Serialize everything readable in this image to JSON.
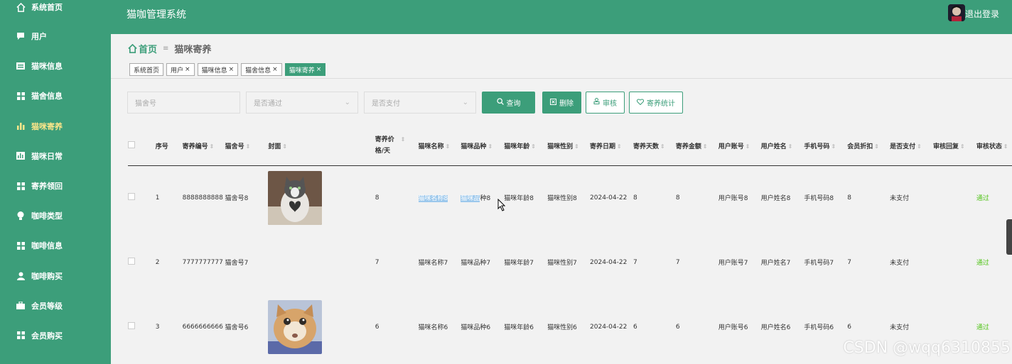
{
  "sidebar": {
    "items": [
      {
        "label": "系统首页",
        "icon": "home-icon"
      },
      {
        "label": "用户",
        "icon": "chat-icon"
      },
      {
        "label": "猫咪信息",
        "icon": "card-icon"
      },
      {
        "label": "猫舍信息",
        "icon": "grid-icon"
      },
      {
        "label": "猫咪寄养",
        "icon": "bar-chart-icon"
      },
      {
        "label": "猫咪日常",
        "icon": "chart-icon"
      },
      {
        "label": "寄养领回",
        "icon": "grid-icon"
      },
      {
        "label": "咖啡类型",
        "icon": "bulb-icon"
      },
      {
        "label": "咖啡信息",
        "icon": "grid-icon"
      },
      {
        "label": "咖啡购买",
        "icon": "user-icon"
      },
      {
        "label": "会员等级",
        "icon": "briefcase-icon"
      },
      {
        "label": "会员购买",
        "icon": "grid-icon"
      }
    ]
  },
  "header": {
    "title": "猫咖管理系统",
    "logout": "退出登录"
  },
  "breadcrumb": {
    "home": "首页",
    "sep": "≡",
    "current": "猫咪寄养"
  },
  "tabs": [
    "系统首页",
    "用户",
    "猫咪信息",
    "猫舍信息",
    "猫咪寄养"
  ],
  "tab_close": "×",
  "filters": {
    "cattery_placeholder": "猫舍号",
    "passed_placeholder": "是否通过",
    "paid_placeholder": "是否支付",
    "query": "查询",
    "delete": "删除",
    "audit": "审核",
    "stats": "寄养统计"
  },
  "table": {
    "columns": [
      "序号",
      "寄养编号",
      "猫舍号",
      "封面",
      "寄养价格/天",
      "猫咪名称",
      "猫咪品种",
      "猫咪年龄",
      "猫咪性别",
      "寄养日期",
      "寄养天数",
      "寄养金额",
      "用户账号",
      "用户姓名",
      "手机号码",
      "会员折扣",
      "是否支付",
      "审核回复",
      "审核状态"
    ],
    "rows": [
      {
        "no": "1",
        "code": "8888888888",
        "cattery": "猫舍号8",
        "cover": "cat-photo-1",
        "price": "8",
        "name": "猫咪名称8",
        "breed": "猫咪品种8",
        "age": "猫咪年龄8",
        "gender": "猫咪性别8",
        "date": "2024-04-22",
        "days": "8",
        "amount": "8",
        "account": "用户账号8",
        "uname": "用户姓名8",
        "phone": "手机号码8",
        "discount": "8",
        "paid": "未支付",
        "reply": "",
        "status": "通过"
      },
      {
        "no": "2",
        "code": "7777777777",
        "cattery": "猫舍号7",
        "cover": "",
        "price": "7",
        "name": "猫咪名称7",
        "breed": "猫咪品种7",
        "age": "猫咪年龄7",
        "gender": "猫咪性别7",
        "date": "2024-04-22",
        "days": "7",
        "amount": "7",
        "account": "用户账号7",
        "uname": "用户姓名7",
        "phone": "手机号码7",
        "discount": "7",
        "paid": "未支付",
        "reply": "",
        "status": "通过"
      },
      {
        "no": "3",
        "code": "6666666666",
        "cattery": "猫舍号6",
        "cover": "cat-photo-2",
        "price": "6",
        "name": "猫咪名称6",
        "breed": "猫咪品种6",
        "age": "猫咪年龄6",
        "gender": "猫咪性别6",
        "date": "2024-04-22",
        "days": "6",
        "amount": "6",
        "account": "用户账号6",
        "uname": "用户姓名6",
        "phone": "手机号码6",
        "discount": "6",
        "paid": "未支付",
        "reply": "",
        "status": "通过"
      }
    ]
  },
  "row1_breed_selected": "猫咪品",
  "row1_breed_rest": "种8",
  "watermark": "CSDN @wqq6310855"
}
